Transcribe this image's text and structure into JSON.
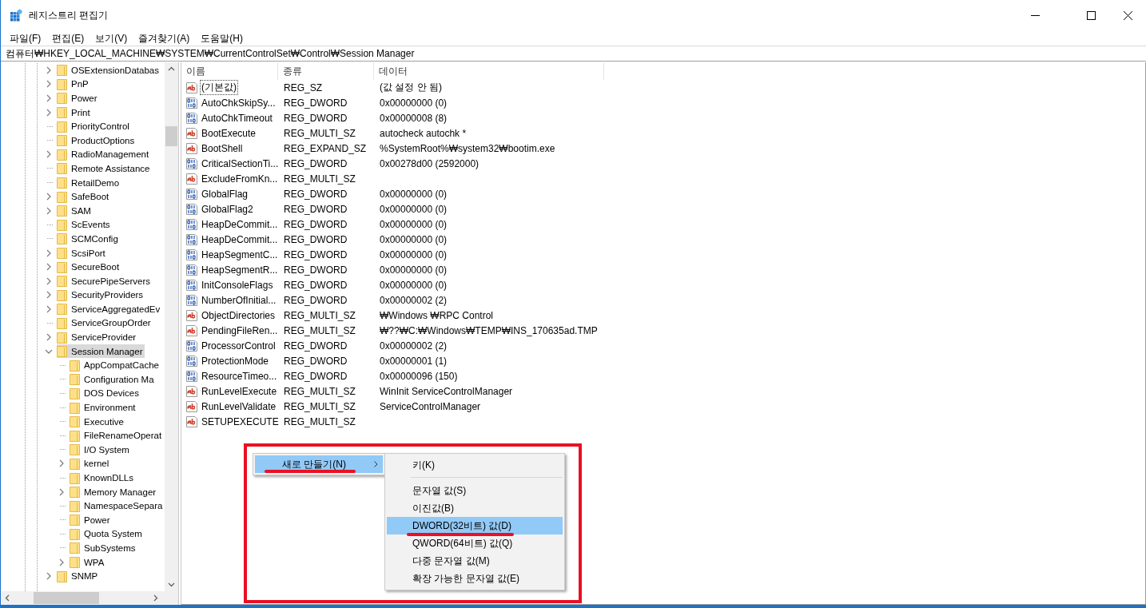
{
  "window": {
    "title": "레지스트리 편집기"
  },
  "menu_bar": [
    "파일(F)",
    "편집(E)",
    "보기(V)",
    "즐겨찾기(A)",
    "도움말(H)"
  ],
  "address": "컴퓨터₩HKEY_LOCAL_MACHINE₩SYSTEM₩CurrentControlSet₩Control₩Session Manager",
  "tree": [
    {
      "label": "OSExtensionDatabas",
      "expandable": true,
      "expanded": false,
      "selected": false
    },
    {
      "label": "PnP",
      "expandable": true,
      "expanded": false,
      "selected": false
    },
    {
      "label": "Power",
      "expandable": true,
      "expanded": false,
      "selected": false
    },
    {
      "label": "Print",
      "expandable": true,
      "expanded": false,
      "selected": false
    },
    {
      "label": "PriorityControl",
      "expandable": false,
      "expanded": false,
      "selected": false
    },
    {
      "label": "ProductOptions",
      "expandable": false,
      "expanded": false,
      "selected": false
    },
    {
      "label": "RadioManagement",
      "expandable": true,
      "expanded": false,
      "selected": false
    },
    {
      "label": "Remote Assistance",
      "expandable": false,
      "expanded": false,
      "selected": false
    },
    {
      "label": "RetailDemo",
      "expandable": false,
      "expanded": false,
      "selected": false
    },
    {
      "label": "SafeBoot",
      "expandable": true,
      "expanded": false,
      "selected": false
    },
    {
      "label": "SAM",
      "expandable": true,
      "expanded": false,
      "selected": false
    },
    {
      "label": "ScEvents",
      "expandable": false,
      "expanded": false,
      "selected": false
    },
    {
      "label": "SCMConfig",
      "expandable": false,
      "expanded": false,
      "selected": false
    },
    {
      "label": "ScsiPort",
      "expandable": true,
      "expanded": false,
      "selected": false
    },
    {
      "label": "SecureBoot",
      "expandable": true,
      "expanded": false,
      "selected": false
    },
    {
      "label": "SecurePipeServers",
      "expandable": true,
      "expanded": false,
      "selected": false
    },
    {
      "label": "SecurityProviders",
      "expandable": true,
      "expanded": false,
      "selected": false
    },
    {
      "label": "ServiceAggregatedEv",
      "expandable": true,
      "expanded": false,
      "selected": false
    },
    {
      "label": "ServiceGroupOrder",
      "expandable": false,
      "expanded": false,
      "selected": false
    },
    {
      "label": "ServiceProvider",
      "expandable": true,
      "expanded": false,
      "selected": false
    },
    {
      "label": "Session Manager",
      "expandable": true,
      "expanded": true,
      "selected": true,
      "children": [
        {
          "label": "AppCompatCache",
          "expandable": false,
          "expanded": false,
          "selected": false
        },
        {
          "label": "Configuration Ma",
          "expandable": false,
          "expanded": false,
          "selected": false
        },
        {
          "label": "DOS Devices",
          "expandable": false,
          "expanded": false,
          "selected": false
        },
        {
          "label": "Environment",
          "expandable": false,
          "expanded": false,
          "selected": false
        },
        {
          "label": "Executive",
          "expandable": false,
          "expanded": false,
          "selected": false
        },
        {
          "label": "FileRenameOperat",
          "expandable": false,
          "expanded": false,
          "selected": false
        },
        {
          "label": "I/O System",
          "expandable": false,
          "expanded": false,
          "selected": false
        },
        {
          "label": "kernel",
          "expandable": true,
          "expanded": false,
          "selected": false
        },
        {
          "label": "KnownDLLs",
          "expandable": false,
          "expanded": false,
          "selected": false
        },
        {
          "label": "Memory Manager",
          "expandable": true,
          "expanded": false,
          "selected": false
        },
        {
          "label": "NamespaceSepara",
          "expandable": false,
          "expanded": false,
          "selected": false
        },
        {
          "label": "Power",
          "expandable": false,
          "expanded": false,
          "selected": false
        },
        {
          "label": "Quota System",
          "expandable": false,
          "expanded": false,
          "selected": false
        },
        {
          "label": "SubSystems",
          "expandable": false,
          "expanded": false,
          "selected": false
        },
        {
          "label": "WPA",
          "expandable": true,
          "expanded": false,
          "selected": false
        }
      ]
    },
    {
      "label": "SNMP",
      "expandable": true,
      "expanded": false,
      "selected": false
    }
  ],
  "table": {
    "columns": [
      "이름",
      "종류",
      "데이터"
    ],
    "rows": [
      {
        "kind": "sz",
        "name": "(기본값)",
        "type": "REG_SZ",
        "data": "(값 설정 안 됨)",
        "focused": true
      },
      {
        "kind": "dword",
        "name": "AutoChkSkipSy...",
        "type": "REG_DWORD",
        "data": "0x00000000 (0)",
        "focused": false
      },
      {
        "kind": "dword",
        "name": "AutoChkTimeout",
        "type": "REG_DWORD",
        "data": "0x00000008 (8)",
        "focused": false
      },
      {
        "kind": "sz",
        "name": "BootExecute",
        "type": "REG_MULTI_SZ",
        "data": "autocheck autochk *",
        "focused": false
      },
      {
        "kind": "sz",
        "name": "BootShell",
        "type": "REG_EXPAND_SZ",
        "data": "%SystemRoot%₩system32₩bootim.exe",
        "focused": false
      },
      {
        "kind": "dword",
        "name": "CriticalSectionTi...",
        "type": "REG_DWORD",
        "data": "0x00278d00 (2592000)",
        "focused": false
      },
      {
        "kind": "sz",
        "name": "ExcludeFromKn...",
        "type": "REG_MULTI_SZ",
        "focused": false
      },
      {
        "kind": "dword",
        "name": "GlobalFlag",
        "type": "REG_DWORD",
        "data": "0x00000000 (0)",
        "focused": false
      },
      {
        "kind": "dword",
        "name": "GlobalFlag2",
        "type": "REG_DWORD",
        "data": "0x00000000 (0)",
        "focused": false
      },
      {
        "kind": "dword",
        "name": "HeapDeCommit...",
        "type": "REG_DWORD",
        "data": "0x00000000 (0)",
        "focused": false
      },
      {
        "kind": "dword",
        "name": "HeapDeCommit...",
        "type": "REG_DWORD",
        "data": "0x00000000 (0)",
        "focused": false
      },
      {
        "kind": "dword",
        "name": "HeapSegmentC...",
        "type": "REG_DWORD",
        "data": "0x00000000 (0)",
        "focused": false
      },
      {
        "kind": "dword",
        "name": "HeapSegmentR...",
        "type": "REG_DWORD",
        "data": "0x00000000 (0)",
        "focused": false
      },
      {
        "kind": "dword",
        "name": "InitConsoleFlags",
        "type": "REG_DWORD",
        "data": "0x00000000 (0)",
        "focused": false
      },
      {
        "kind": "dword",
        "name": "NumberOfInitial...",
        "type": "REG_DWORD",
        "data": "0x00000002 (2)",
        "focused": false
      },
      {
        "kind": "sz",
        "name": "ObjectDirectories",
        "type": "REG_MULTI_SZ",
        "data": "₩Windows ₩RPC Control",
        "focused": false
      },
      {
        "kind": "sz",
        "name": "PendingFileRen...",
        "type": "REG_MULTI_SZ",
        "data": "₩??₩C:₩Windows₩TEMP₩INS_170635ad.TMP",
        "focused": false
      },
      {
        "kind": "dword",
        "name": "ProcessorControl",
        "type": "REG_DWORD",
        "data": "0x00000002 (2)",
        "focused": false
      },
      {
        "kind": "dword",
        "name": "ProtectionMode",
        "type": "REG_DWORD",
        "data": "0x00000001 (1)",
        "focused": false
      },
      {
        "kind": "dword",
        "name": "ResourceTimeo...",
        "type": "REG_DWORD",
        "data": "0x00000096 (150)",
        "focused": false
      },
      {
        "kind": "sz",
        "name": "RunLevelExecute",
        "type": "REG_MULTI_SZ",
        "data": "WinInit ServiceControlManager",
        "focused": false
      },
      {
        "kind": "sz",
        "name": "RunLevelValidate",
        "type": "REG_MULTI_SZ",
        "data": "ServiceControlManager",
        "focused": false
      },
      {
        "kind": "sz",
        "name": "SETUPEXECUTE",
        "type": "REG_MULTI_SZ",
        "focused": false
      }
    ]
  },
  "context_menu": {
    "annotated": true,
    "items": [
      {
        "label": "새로 만들기(N)",
        "selected": true,
        "underlined": true,
        "has_submenu": true
      }
    ],
    "submenu": [
      {
        "kind": "item",
        "label": "키(K)",
        "selected": false,
        "underlined": false
      },
      {
        "kind": "separator"
      },
      {
        "kind": "item",
        "label": "문자열 값(S)",
        "selected": false,
        "underlined": false
      },
      {
        "kind": "item",
        "label": "이진값(B)",
        "selected": false,
        "underlined": false
      },
      {
        "kind": "item",
        "label": "DWORD(32비트) 값(D)",
        "selected": true,
        "underlined": true
      },
      {
        "kind": "item",
        "label": "QWORD(64비트) 값(Q)",
        "selected": false,
        "underlined": false
      },
      {
        "kind": "item",
        "label": "다중 문자열 값(M)",
        "selected": false,
        "underlined": false
      },
      {
        "kind": "item",
        "label": "확장 가능한 문자열 값(E)",
        "selected": false,
        "underlined": false
      }
    ]
  }
}
